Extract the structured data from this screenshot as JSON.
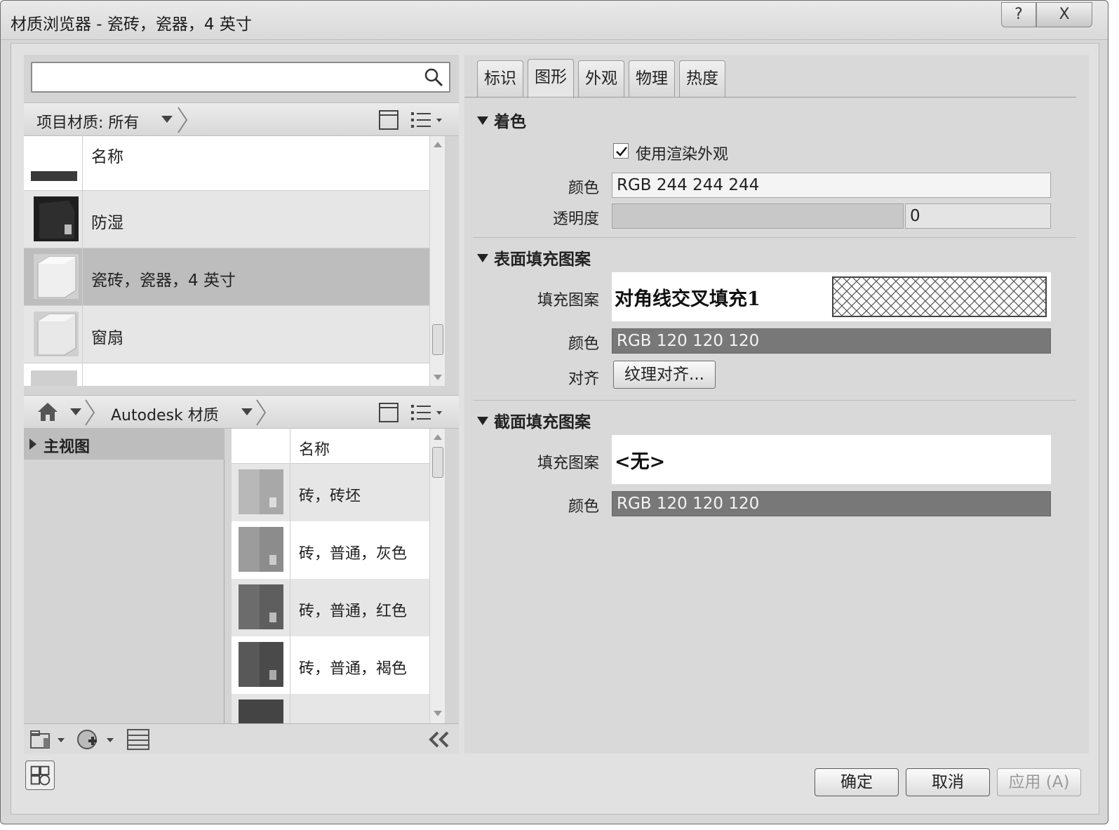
{
  "window": {
    "title": "材质浏览器 - 瓷砖，瓷器，4 英寸",
    "help_label": "?",
    "close_label": "X"
  },
  "search": {
    "value": "",
    "placeholder": ""
  },
  "project_bar": {
    "label": "项目材质: 所有"
  },
  "project_list": {
    "header": "名称",
    "items": [
      {
        "label": "防湿",
        "swatch": "#2a2a2a"
      },
      {
        "label": "瓷砖，瓷器，4 英寸",
        "swatch": "#e8e8e8",
        "selected": true
      },
      {
        "label": "窗扇",
        "swatch": "#e0e0e0"
      }
    ]
  },
  "library_bar": {
    "label": "Autodesk 材质"
  },
  "tree": {
    "item": "主视图"
  },
  "library_list": {
    "header": "名称",
    "items": [
      {
        "label": "砖，砖坯",
        "swatch": "#a8a8a8"
      },
      {
        "label": "砖，普通，灰色",
        "swatch": "#8c8c8c"
      },
      {
        "label": "砖，普通，红色",
        "swatch": "#5e5e5e"
      },
      {
        "label": "砖，普通，褐色",
        "swatch": "#4a4a4a"
      }
    ]
  },
  "tabs": [
    "标识",
    "图形",
    "外观",
    "物理",
    "热度"
  ],
  "active_tab": "图形",
  "shading": {
    "title": "着色",
    "use_render_label": "使用渲染外观",
    "use_render_checked": true,
    "color_label": "颜色",
    "color_value": "RGB 244 244 244",
    "transparency_label": "透明度",
    "transparency_value": "0"
  },
  "surface_pattern": {
    "title": "表面填充图案",
    "pattern_label": "填充图案",
    "pattern_value": "对角线交叉填充1",
    "color_label": "颜色",
    "color_value": "RGB 120 120 120",
    "align_label": "对齐",
    "align_button": "纹理对齐..."
  },
  "cut_pattern": {
    "title": "截面填充图案",
    "pattern_label": "填充图案",
    "pattern_value": "<无>",
    "color_label": "颜色",
    "color_value": "RGB 120 120 120"
  },
  "footer": {
    "ok": "确定",
    "cancel": "取消",
    "apply": "应用 (A)"
  },
  "colors": {
    "dark_field": "#787878",
    "selected_row": "#bdbdbd"
  }
}
